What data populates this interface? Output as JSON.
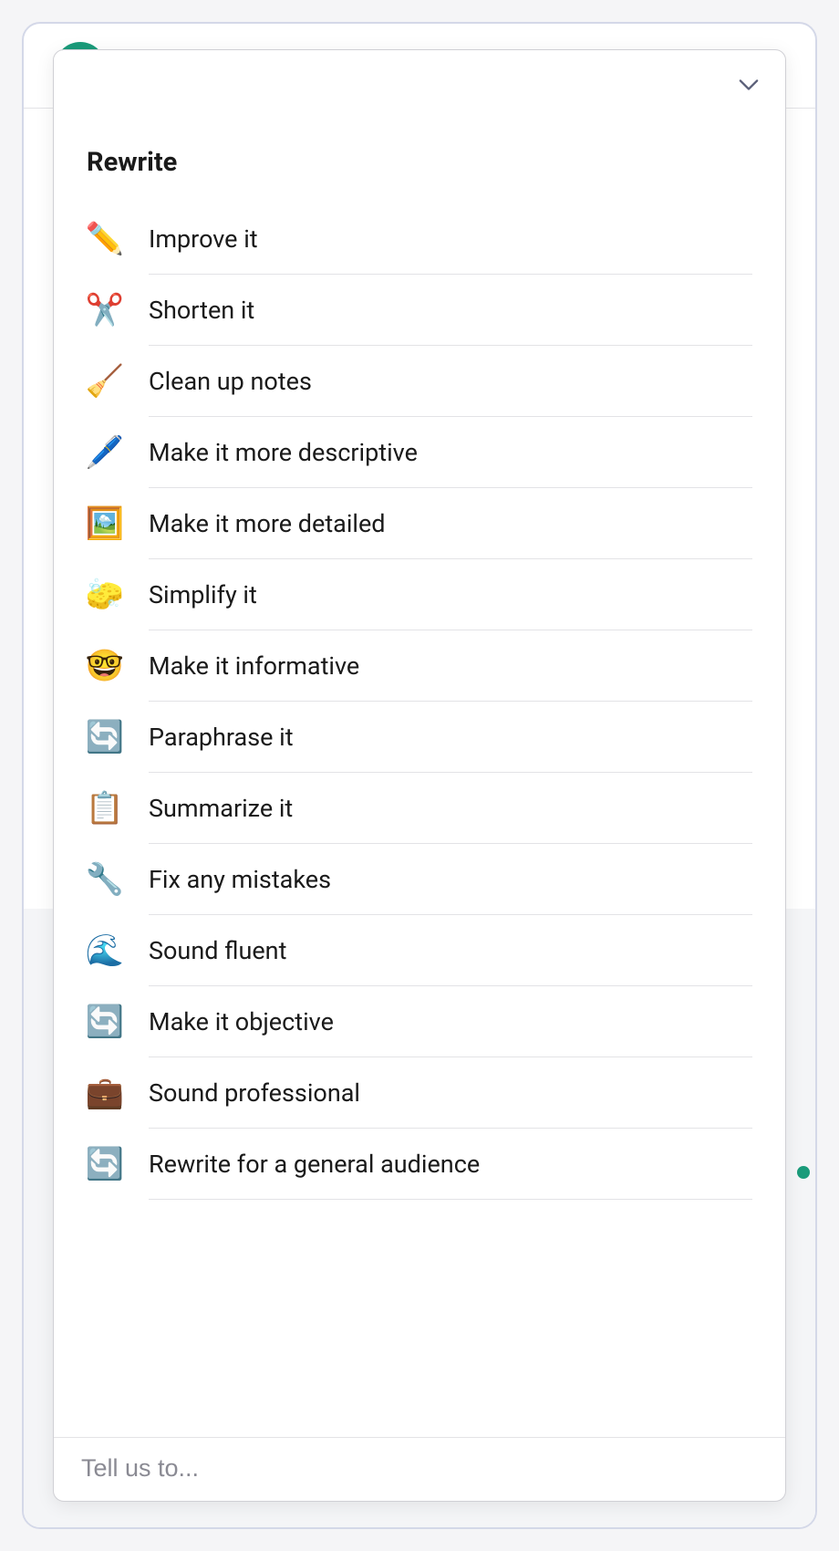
{
  "section_title": "Rewrite",
  "items": [
    {
      "icon": "✏️",
      "label": "Improve it",
      "name": "rewrite-item-improve-it"
    },
    {
      "icon": "✂️",
      "label": "Shorten it",
      "name": "rewrite-item-shorten-it"
    },
    {
      "icon": "🧹",
      "label": "Clean up notes",
      "name": "rewrite-item-clean-up-notes"
    },
    {
      "icon": "🖊️",
      "label": "Make it more descriptive",
      "name": "rewrite-item-more-descriptive"
    },
    {
      "icon": "🖼️",
      "label": "Make it more detailed",
      "name": "rewrite-item-more-detailed"
    },
    {
      "icon": "🧽",
      "label": "Simplify it",
      "name": "rewrite-item-simplify-it"
    },
    {
      "icon": "🤓",
      "label": "Make it informative",
      "name": "rewrite-item-informative"
    },
    {
      "icon": "🔄",
      "label": "Paraphrase it",
      "name": "rewrite-item-paraphrase-it"
    },
    {
      "icon": "📋",
      "label": "Summarize it",
      "name": "rewrite-item-summarize-it"
    },
    {
      "icon": "🔧",
      "label": "Fix any mistakes",
      "name": "rewrite-item-fix-mistakes"
    },
    {
      "icon": "🌊",
      "label": "Sound fluent",
      "name": "rewrite-item-sound-fluent"
    },
    {
      "icon": "🔄",
      "label": "Make it objective",
      "name": "rewrite-item-objective"
    },
    {
      "icon": "💼",
      "label": "Sound professional",
      "name": "rewrite-item-professional"
    },
    {
      "icon": "🔄",
      "label": "Rewrite for a general audience",
      "name": "rewrite-item-general-audience"
    }
  ],
  "input": {
    "placeholder": "Tell us to..."
  }
}
